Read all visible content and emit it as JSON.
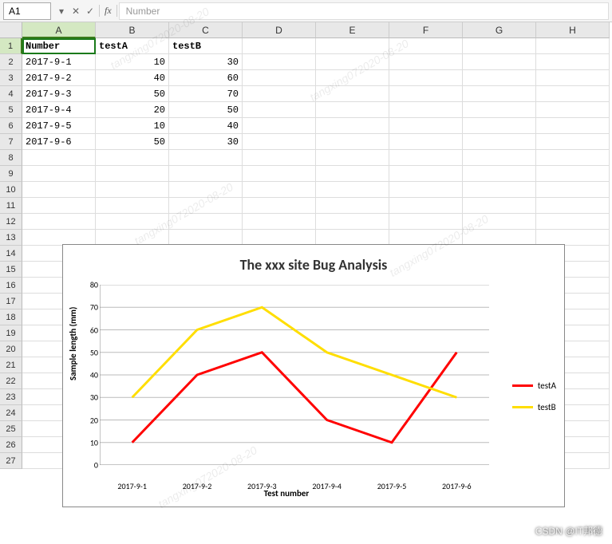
{
  "formula_bar": {
    "name_box": "A1",
    "fx": "fx",
    "value": "Number"
  },
  "columns": [
    "A",
    "B",
    "C",
    "D",
    "E",
    "F",
    "G",
    "H"
  ],
  "active_col_index": 0,
  "active_row_index": 0,
  "row_count": 27,
  "table": {
    "headers": [
      "Number",
      "testA",
      "testB"
    ],
    "rows": [
      {
        "number": "2017-9-1",
        "a": 10,
        "b": 30
      },
      {
        "number": "2017-9-2",
        "a": 40,
        "b": 60
      },
      {
        "number": "2017-9-3",
        "a": 50,
        "b": 70
      },
      {
        "number": "2017-9-4",
        "a": 20,
        "b": 50
      },
      {
        "number": "2017-9-5",
        "a": 10,
        "b": 40
      },
      {
        "number": "2017-9-6",
        "a": 50,
        "b": 30
      }
    ]
  },
  "chart_data": {
    "type": "line",
    "title": "The xxx site Bug Analysis",
    "xlabel": "Test number",
    "ylabel": "Sample length (mm)",
    "ylim": [
      0,
      80
    ],
    "ytick_step": 10,
    "categories": [
      "2017-9-1",
      "2017-9-2",
      "2017-9-3",
      "2017-9-4",
      "2017-9-5",
      "2017-9-6"
    ],
    "series": [
      {
        "name": "testA",
        "color": "#ff0000",
        "values": [
          10,
          40,
          50,
          20,
          10,
          50
        ]
      },
      {
        "name": "testB",
        "color": "#ffde00",
        "values": [
          30,
          60,
          70,
          50,
          40,
          30
        ]
      }
    ]
  },
  "watermarks": [
    "tangxing072020-08-20",
    "tangxing072020-08-20",
    "tangxing072020-08-20",
    "tangxing072020-08-20",
    "tangxing072020-08-20"
  ],
  "credit": "CSDN @IT邦德"
}
